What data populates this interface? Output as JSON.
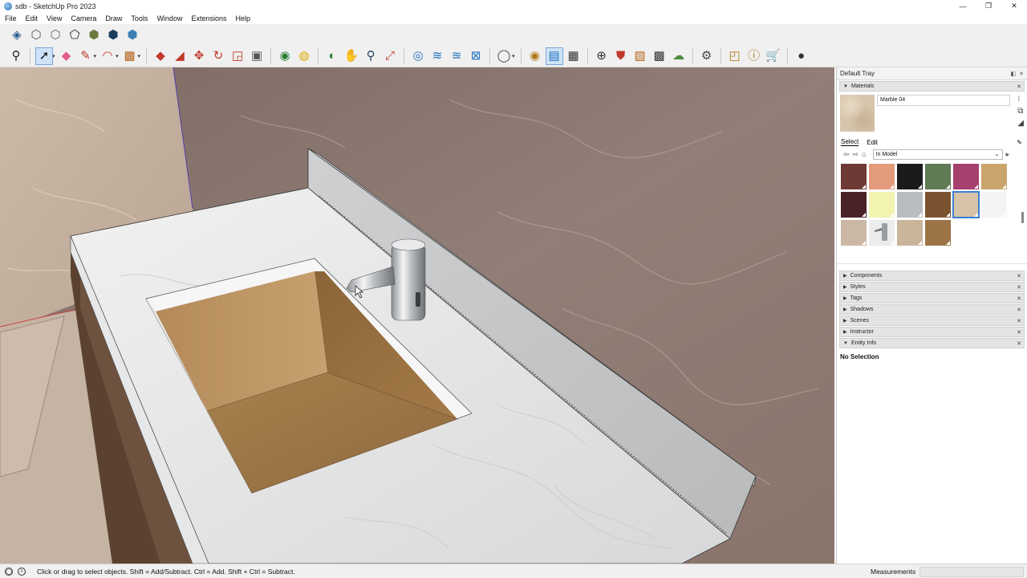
{
  "window": {
    "title": "sdb - SketchUp Pro 2023",
    "controls": [
      "—",
      "❐",
      "✕"
    ]
  },
  "menu": [
    "File",
    "Edit",
    "View",
    "Camera",
    "Draw",
    "Tools",
    "Window",
    "Extensions",
    "Help"
  ],
  "toolbar_top": [
    {
      "name": "xray-style-icon",
      "glyph": "◈",
      "color": "#2c5f8f"
    },
    {
      "name": "back-edges-style-icon",
      "glyph": "⬡",
      "color": "#555555"
    },
    {
      "name": "wireframe-style-icon",
      "glyph": "⬡",
      "color": "#666666"
    },
    {
      "name": "hidden-line-style-icon",
      "glyph": "⬠",
      "color": "#222222"
    },
    {
      "name": "shaded-style-icon",
      "glyph": "⬢",
      "color": "#6b7a3a"
    },
    {
      "name": "shaded-textures-style-icon",
      "glyph": "⬢",
      "color": "#1d3d5c"
    },
    {
      "name": "monochrome-style-icon",
      "glyph": "⬢",
      "color": "#3d7fb5"
    }
  ],
  "toolbar_main": [
    {
      "name": "search-icon",
      "glyph": "⚲",
      "color": "#222222",
      "sep_after": true
    },
    {
      "name": "select-tool-icon",
      "glyph": "➚",
      "color": "#111111",
      "active": true,
      "drop": true
    },
    {
      "name": "eraser-tool-icon",
      "glyph": "◆",
      "color": "#e05a8a"
    },
    {
      "name": "line-tool-icon",
      "glyph": "✎",
      "color": "#c0392b",
      "drop": true
    },
    {
      "name": "arc-tool-icon",
      "glyph": "◠",
      "color": "#c0392b",
      "drop": true
    },
    {
      "name": "shape-tool-icon",
      "glyph": "▩",
      "color": "#b5651d",
      "drop": true,
      "sep_after": true
    },
    {
      "name": "push-pull-tool-icon",
      "glyph": "◆",
      "color": "#c0392b"
    },
    {
      "name": "follow-me-tool-icon",
      "glyph": "◢",
      "color": "#c0392b"
    },
    {
      "name": "move-tool-icon",
      "glyph": "✥",
      "color": "#c0392b"
    },
    {
      "name": "rotate-tool-icon",
      "glyph": "↻",
      "color": "#c0392b"
    },
    {
      "name": "scale-tool-icon",
      "glyph": "◲",
      "color": "#c0392b"
    },
    {
      "name": "offset-tool-icon",
      "glyph": "▣",
      "color": "#555555",
      "sep_after": true
    },
    {
      "name": "tape-measure-icon",
      "glyph": "◉",
      "color": "#2e7d32"
    },
    {
      "name": "paint-bucket-icon",
      "glyph": "◍",
      "color": "#e0a800",
      "sep_after": true
    },
    {
      "name": "orbit-tool-icon",
      "glyph": "◐",
      "color": "#2e7d32"
    },
    {
      "name": "pan-tool-icon",
      "glyph": "✋",
      "color": "#e0a800"
    },
    {
      "name": "zoom-tool-icon",
      "glyph": "⚲",
      "color": "#1d3d5c"
    },
    {
      "name": "zoom-extents-icon",
      "glyph": "⤢",
      "color": "#c0392b",
      "sep_after": true
    },
    {
      "name": "geo-location-icon",
      "glyph": "◎",
      "color": "#1e70c1"
    },
    {
      "name": "section-plane-icon",
      "glyph": "≋",
      "color": "#1e70c1"
    },
    {
      "name": "section-display-icon",
      "glyph": "≊",
      "color": "#1e70c1"
    },
    {
      "name": "section-fill-icon",
      "glyph": "⊠",
      "color": "#1e70c1",
      "sep_after": true
    },
    {
      "name": "user-account-icon",
      "glyph": "◯",
      "color": "#444444",
      "drop": true,
      "sep_after": true
    },
    {
      "name": "extension-manager-icon",
      "glyph": "◉",
      "color": "#b07a1a"
    },
    {
      "name": "component-options-icon",
      "glyph": "▤",
      "color": "#1e70c1",
      "active": true
    },
    {
      "name": "trimble-connect-icon",
      "glyph": "▦",
      "color": "#333333",
      "sep_after": true
    },
    {
      "name": "add-location-icon",
      "glyph": "⊕",
      "color": "#333333"
    },
    {
      "name": "warehouse-icon",
      "glyph": "⛊",
      "color": "#c0392b"
    },
    {
      "name": "extension-warehouse-icon",
      "glyph": "▧",
      "color": "#b5651d"
    },
    {
      "name": "materials-icon",
      "glyph": "▩",
      "color": "#333333"
    },
    {
      "name": "cloud-icon",
      "glyph": "☁",
      "color": "#4a8a3a",
      "sep_after": true
    },
    {
      "name": "settings-gear-icon",
      "glyph": "⚙",
      "color": "#444444",
      "sep_after": true
    },
    {
      "name": "layout-icon",
      "glyph": "◰",
      "color": "#b07a1a"
    },
    {
      "name": "info-icon",
      "glyph": "ⓘ",
      "color": "#b07a1a"
    },
    {
      "name": "cart-icon",
      "glyph": "🛒",
      "color": "#333333",
      "sep_after": true
    },
    {
      "name": "profile-icon",
      "glyph": "●",
      "color": "#333333"
    }
  ],
  "tray": {
    "title": "Default Tray",
    "materials": {
      "panel_label": "Materials",
      "current_name": "Marble 04",
      "tab_select": "Select",
      "tab_edit": "Edit",
      "collection": "In Model",
      "swatches": [
        {
          "color": "#6e3a36"
        },
        {
          "color": "#e39b7c"
        },
        {
          "color": "#1b1b1b"
        },
        {
          "color": "#5f7a54"
        },
        {
          "color": "#a5406f"
        },
        {
          "color": "#c9a46b"
        },
        {
          "color": "#4a2226"
        },
        {
          "color": "#f2f3b0"
        },
        {
          "color": "#b9bcc0"
        },
        {
          "color": "#7a5230"
        },
        {
          "color": "#d6c3a8",
          "selected": true
        },
        {
          "color": "#f4f4f4"
        },
        {
          "color": "#cbb8a4"
        },
        {
          "color": "#ececec",
          "faucet": true
        },
        {
          "color": "#c9b49c"
        },
        {
          "color": "#9c7447"
        }
      ]
    },
    "panels": [
      "Components",
      "Styles",
      "Tags",
      "Shadows",
      "Scenes",
      "Instructor",
      "Entity Info"
    ],
    "entity_info": "No Selection"
  },
  "status": {
    "hint": "Click or drag to select objects. Shift = Add/Subtract. Ctrl = Add. Shift + Ctrl = Subtract.",
    "measurements_label": "Measurements",
    "measurements_value": ""
  }
}
